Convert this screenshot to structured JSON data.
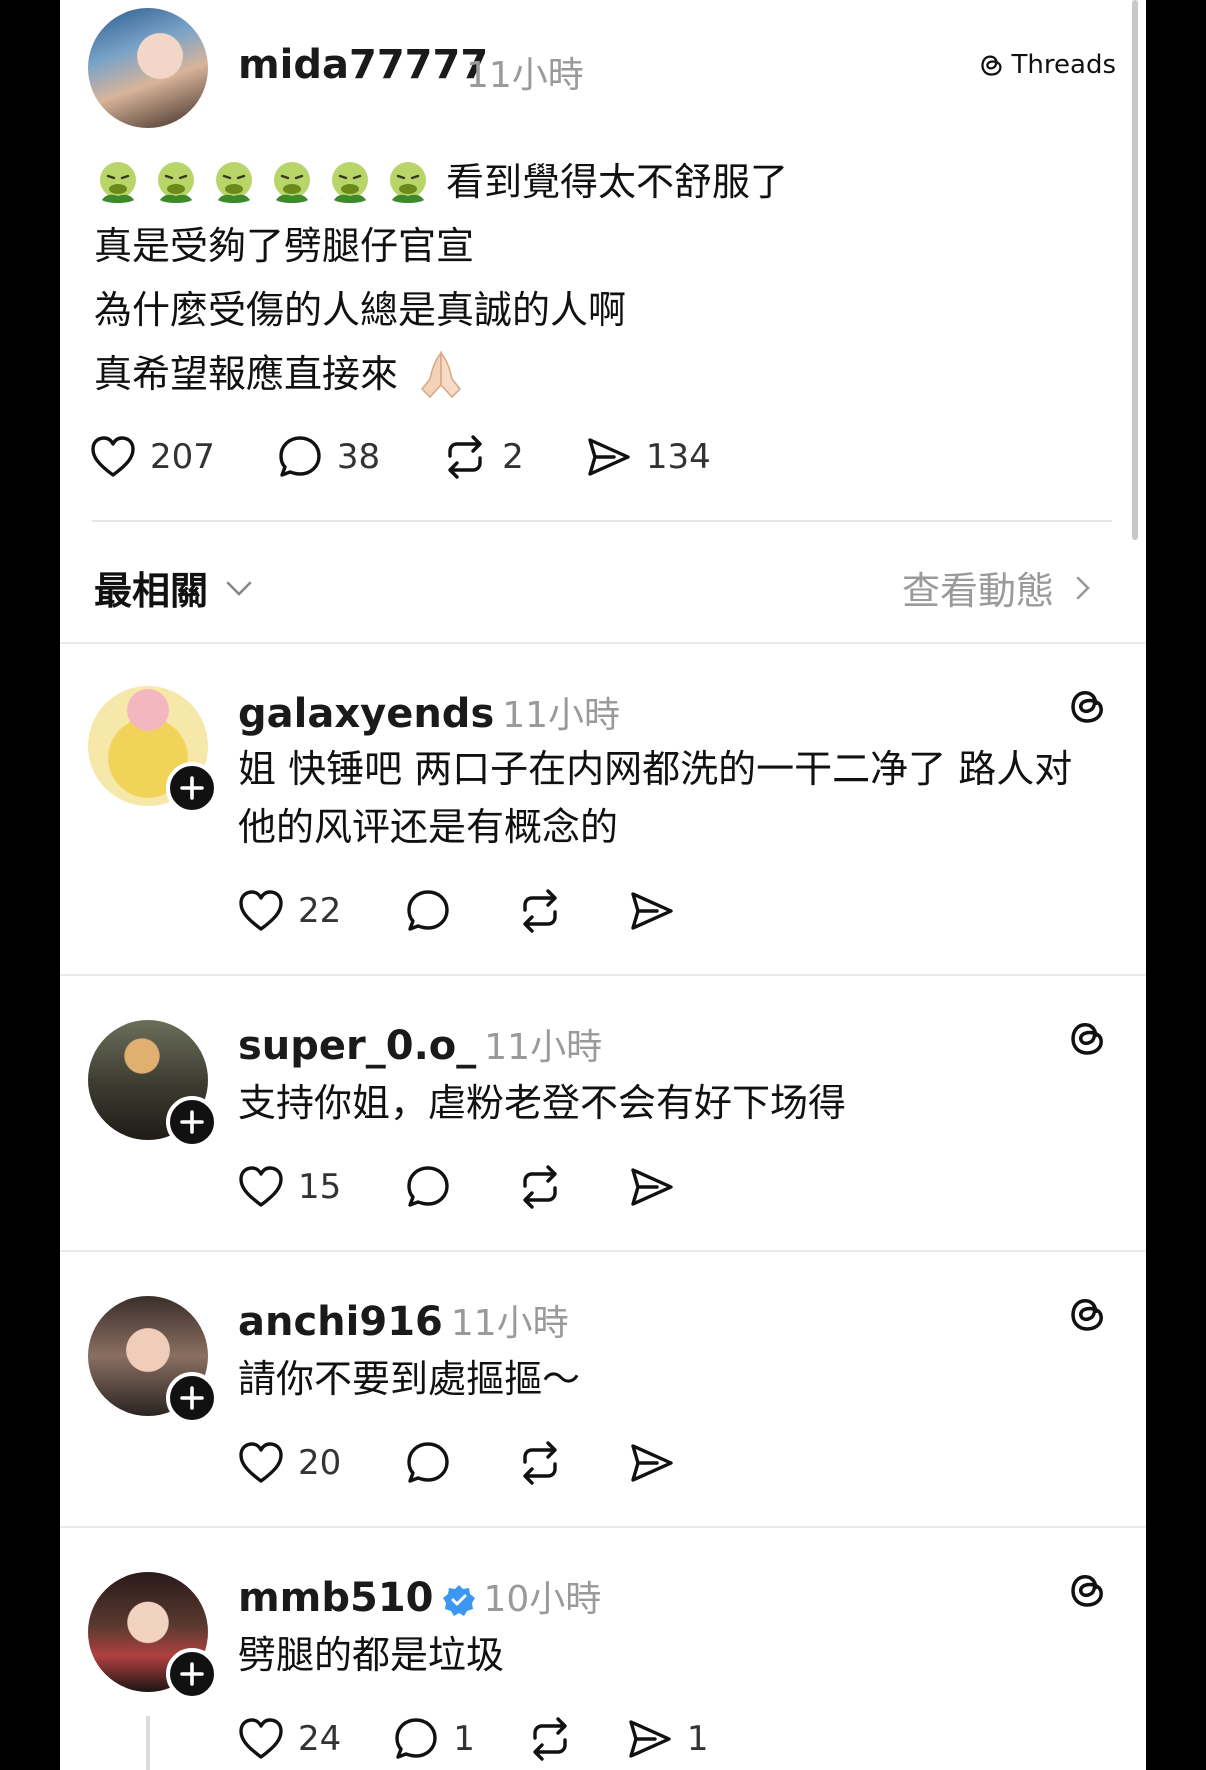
{
  "post": {
    "username": "mida77777",
    "time": "11小時",
    "brand": "Threads",
    "emoji_count": 6,
    "line1": "看到覺得太不舒服了",
    "line2": "真是受夠了劈腿仔官宣",
    "line3": "為什麼受傷的人總是真誠的人啊",
    "line4": "真希望報應直接來",
    "likes": "207",
    "comments": "38",
    "reposts": "2",
    "shares": "134"
  },
  "sort": {
    "label": "最相關",
    "activity_label": "查看動態"
  },
  "replies": [
    {
      "username": "galaxyends",
      "time": "11小時",
      "text": "姐 快锤吧 两口子在内网都洗的一干二净了 路人对他的风评还是有概念的",
      "likes": "22"
    },
    {
      "username": "super_0.o_",
      "time": "11小時",
      "text": "支持你姐，虐粉老登不会有好下场得",
      "likes": "15"
    },
    {
      "username": "anchi916",
      "time": "11小時",
      "text": "請你不要到處摳摳～",
      "likes": "20"
    },
    {
      "username": "mmb510",
      "time": "10小時",
      "verified": true,
      "text": "劈腿的都是垃圾",
      "likes": "24",
      "comments": "1",
      "shares": "1"
    }
  ],
  "colors": {
    "muted": "#9a9a9a",
    "verified": "#3b97f0",
    "divider": "#e6e6e6"
  }
}
